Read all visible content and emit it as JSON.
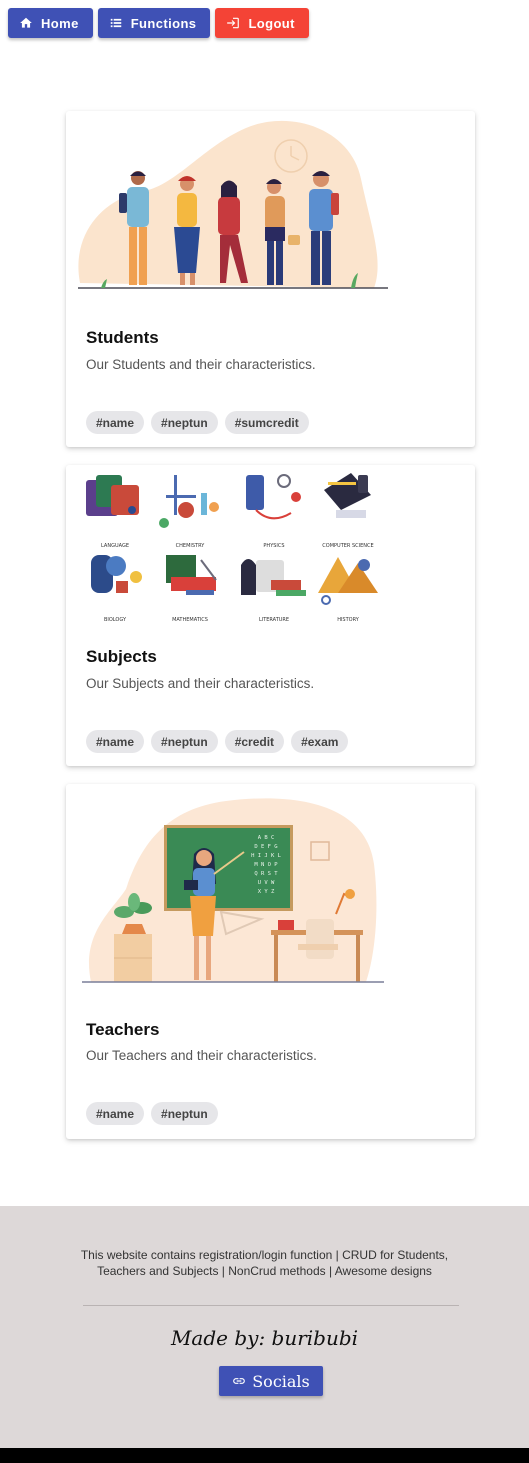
{
  "nav": {
    "home": {
      "label": "Home",
      "icon": "home-icon"
    },
    "functions": {
      "label": "Functions",
      "icon": "list-icon"
    },
    "logout": {
      "label": "Logout",
      "icon": "login-icon"
    }
  },
  "cards": [
    {
      "title": "Students",
      "description": "Our Students and their characteristics.",
      "tags": [
        "#name",
        "#neptun",
        "#sumcredit"
      ]
    },
    {
      "title": "Subjects",
      "description": "Our Subjects and their characteristics.",
      "tags": [
        "#name",
        "#neptun",
        "#credit",
        "#exam"
      ],
      "image_labels": [
        "LANGUAGE",
        "CHEMISTRY",
        "PHYSICS",
        "COMPUTER SCIENCE",
        "BIOLOGY",
        "MATHEMATICS",
        "LITERATURE",
        "HISTORY"
      ]
    },
    {
      "title": "Teachers",
      "description": "Our Teachers and their characteristics.",
      "tags": [
        "#name",
        "#neptun"
      ],
      "board_letters": [
        "A B C",
        "D E F G",
        "H I J K L",
        "M N O P",
        "Q R S T",
        "U V W",
        "X Y Z"
      ]
    }
  ],
  "footer": {
    "line1": "This website contains registration/login function | CRUD for Students,",
    "line2": "Teachers and Subjects | NonCrud methods | Awesome designs",
    "made_by": "Made by: buribubi",
    "socials_label": "Socials",
    "socials_icon": "link-icon"
  },
  "colors": {
    "primary": "#3f51b5",
    "danger": "#f44336",
    "footer_bg": "#ddd8d8"
  }
}
